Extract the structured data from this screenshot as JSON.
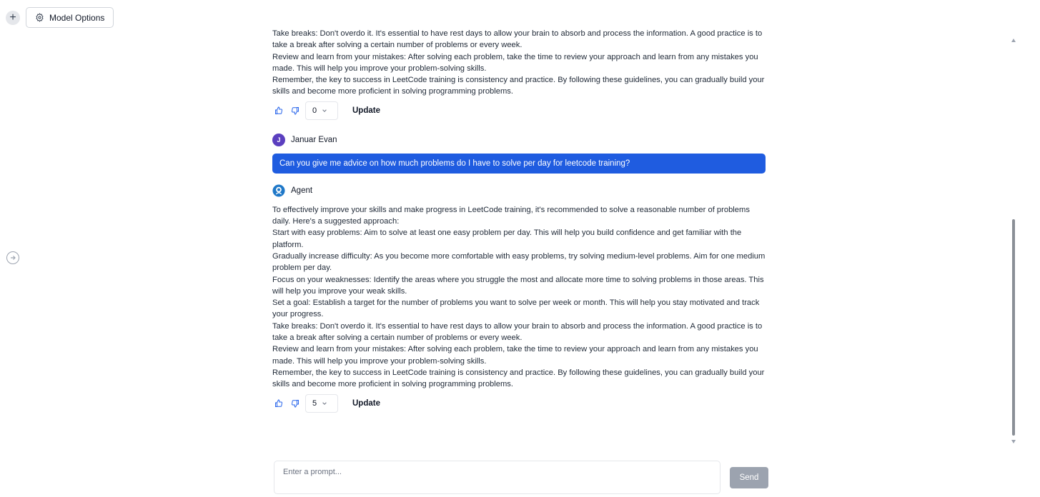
{
  "topbar": {
    "new_label": "+",
    "model_options_label": "Model Options"
  },
  "colors": {
    "user_bubble": "#1f5ce0",
    "user_avatar": "#5b3fbf",
    "agent_avatar": "#1f78c8",
    "send_button": "#9ca3af"
  },
  "messages": [
    {
      "role": "agent",
      "paragraphs": [
        "Take breaks: Don't overdo it. It's essential to have rest days to allow your brain to absorb and process the information. A good practice is to take a break after solving a certain number of problems or every week.",
        "Review and learn from your mistakes: After solving each problem, take the time to review your approach and learn from any mistakes you made. This will help you improve your problem-solving skills.",
        "Remember, the key to success in LeetCode training is consistency and practice. By following these guidelines, you can gradually build your skills and become more proficient in solving programming problems."
      ],
      "rating": "0",
      "update_label": "Update"
    },
    {
      "role": "user",
      "author": "Januar Evan",
      "avatar_letter": "J",
      "text": "Can you give me advice on how much problems do I have to solve per day for leetcode training?"
    },
    {
      "role": "agent",
      "author": "Agent",
      "paragraphs": [
        "To effectively improve your skills and make progress in LeetCode training, it's recommended to solve a reasonable number of problems daily. Here's a suggested approach:",
        "Start with easy problems: Aim to solve at least one easy problem per day. This will help you build confidence and get familiar with the platform.",
        "Gradually increase difficulty: As you become more comfortable with easy problems, try solving medium-level problems. Aim for one medium problem per day.",
        "Focus on your weaknesses: Identify the areas where you struggle the most and allocate more time to solving problems in those areas. This will help you improve your weak skills.",
        "Set a goal: Establish a target for the number of problems you want to solve per week or month. This will help you stay motivated and track your progress.",
        "Take breaks: Don't overdo it. It's essential to have rest days to allow your brain to absorb and process the information. A good practice is to take a break after solving a certain number of problems or every week.",
        "Review and learn from your mistakes: After solving each problem, take the time to review your approach and learn from any mistakes you made. This will help you improve your problem-solving skills.",
        "Remember, the key to success in LeetCode training is consistency and practice. By following these guidelines, you can gradually build your skills and become more proficient in solving programming problems."
      ],
      "rating": "5",
      "update_label": "Update"
    }
  ],
  "prompt": {
    "placeholder": "Enter a prompt...",
    "send_label": "Send"
  }
}
